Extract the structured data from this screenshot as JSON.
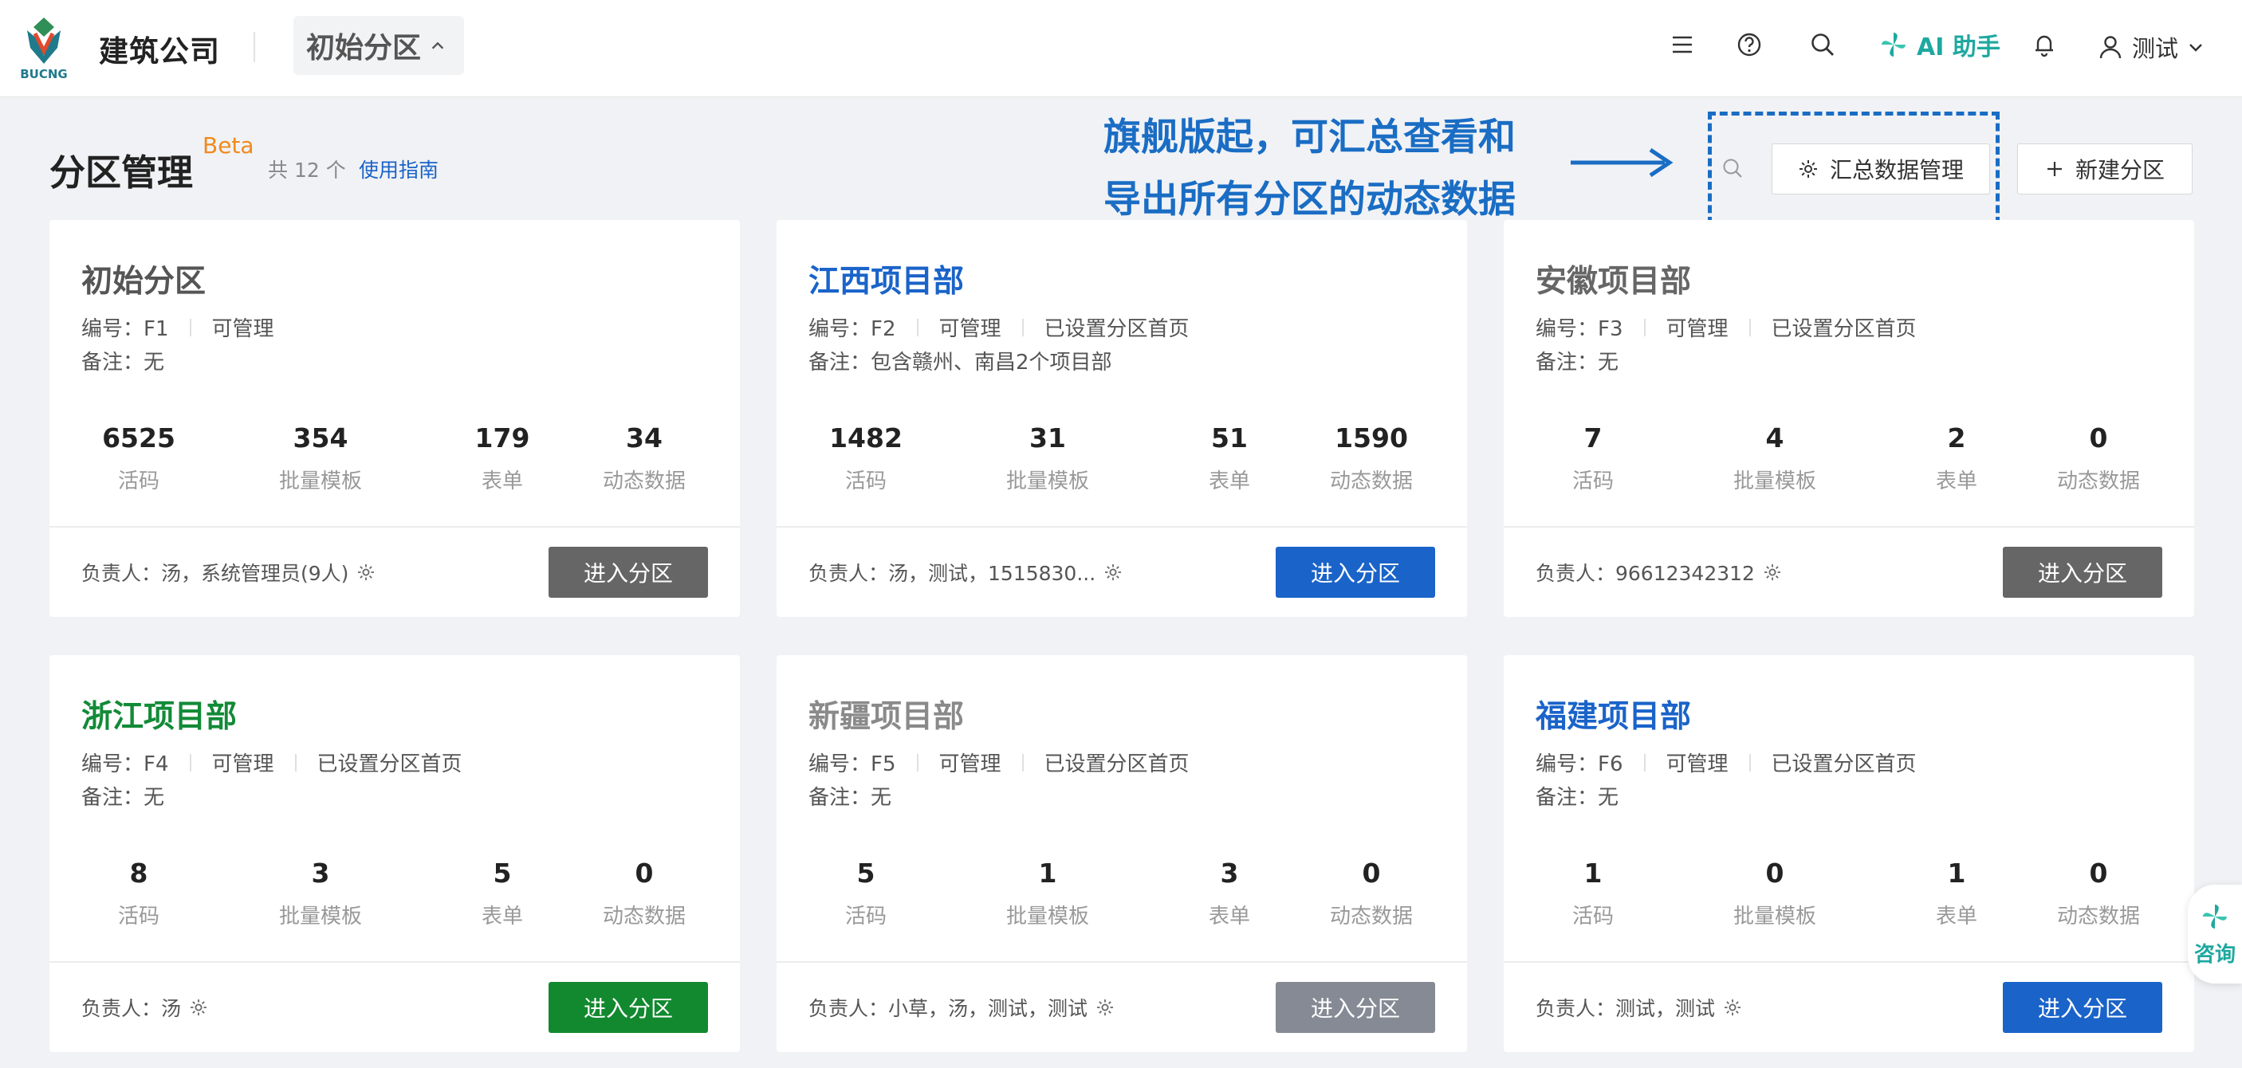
{
  "header": {
    "logo_text": "BUCNG",
    "company": "建筑公司",
    "current_zone": "初始分区",
    "ai_label": "AI 助手",
    "user_name": "测试"
  },
  "page": {
    "title": "分区管理",
    "beta": "Beta",
    "count_text": "共 12 个",
    "guide_link": "使用指南",
    "annotation_line1": "旗舰版起，可汇总查看和",
    "annotation_line2": "导出所有分区的动态数据",
    "summary_button": "汇总数据管理",
    "new_zone_button": "新建分区"
  },
  "stat_labels": [
    "活码",
    "批量模板",
    "表单",
    "动态数据"
  ],
  "cards": [
    {
      "name": "初始分区",
      "name_color": "#555555",
      "code": "编号：F1",
      "perm": "可管理",
      "homepage": "",
      "remark": "备注：无",
      "stats": [
        "6525",
        "354",
        "179",
        "34"
      ],
      "owner": "负责人：汤，系统管理员(9人)",
      "button": "进入分区",
      "button_color": "#666666"
    },
    {
      "name": "江西项目部",
      "name_color": "#1a63c9",
      "code": "编号：F2",
      "perm": "可管理",
      "homepage": "已设置分区首页",
      "remark": "备注：包含赣州、南昌2个项目部",
      "stats": [
        "1482",
        "31",
        "51",
        "1590"
      ],
      "owner": "负责人：汤，测试，1515830...",
      "button": "进入分区",
      "button_color": "#1a63c9"
    },
    {
      "name": "安徽项目部",
      "name_color": "#666666",
      "code": "编号：F3",
      "perm": "可管理",
      "homepage": "已设置分区首页",
      "remark": "备注：无",
      "stats": [
        "7",
        "4",
        "2",
        "0"
      ],
      "owner": "负责人：96612342312",
      "button": "进入分区",
      "button_color": "#666666"
    },
    {
      "name": "浙江项目部",
      "name_color": "#128a37",
      "code": "编号：F4",
      "perm": "可管理",
      "homepage": "已设置分区首页",
      "remark": "备注：无",
      "stats": [
        "8",
        "3",
        "5",
        "0"
      ],
      "owner": "负责人：汤",
      "button": "进入分区",
      "button_color": "#12892f"
    },
    {
      "name": "新疆项目部",
      "name_color": "#8a8a8a",
      "code": "编号：F5",
      "perm": "可管理",
      "homepage": "已设置分区首页",
      "remark": "备注：无",
      "stats": [
        "5",
        "1",
        "3",
        "0"
      ],
      "owner": "负责人：小草，汤，测试，测试",
      "button": "进入分区",
      "button_color": "#858a94"
    },
    {
      "name": "福建项目部",
      "name_color": "#1a63c9",
      "code": "编号：F6",
      "perm": "可管理",
      "homepage": "已设置分区首页",
      "remark": "备注：无",
      "stats": [
        "1",
        "0",
        "1",
        "0"
      ],
      "owner": "负责人：测试，测试",
      "button": "进入分区",
      "button_color": "#1a63c9"
    }
  ],
  "consult_label": "咨询",
  "colors": {
    "accent_blue": "#1a63c9",
    "annotation_blue": "#1a6dc4",
    "beta_orange": "#f08a1c",
    "ai_teal": "#1fa8a0"
  }
}
